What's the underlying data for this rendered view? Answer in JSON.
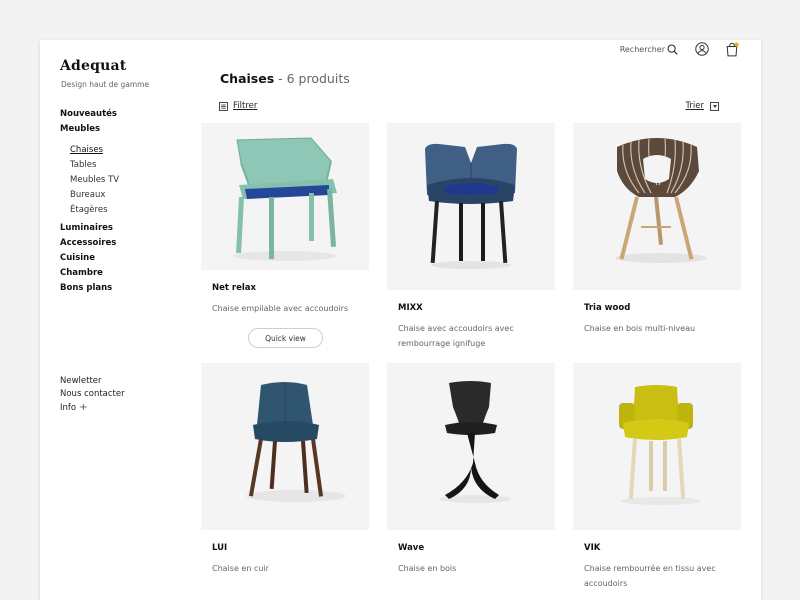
{
  "brand": {
    "logo": "Adequat",
    "tagline": "Design haut de gamme"
  },
  "topbar": {
    "search_label": "Rechercher"
  },
  "nav": {
    "items": [
      "Nouveautés",
      "Meubles",
      "Luminaires",
      "Accessoires",
      "Cuisine",
      "Chambre",
      "Bons plans"
    ],
    "sub_items": [
      "Chaises",
      "Tables",
      "Meubles TV",
      "Bureaux",
      "Étagères"
    ],
    "active_sub": "Chaises"
  },
  "footer": {
    "newsletter": "Newletter",
    "contact": "Nous contacter",
    "info": "Info",
    "info_plus": "+"
  },
  "page": {
    "title": "Chaises",
    "separator": " - ",
    "count": "6 produits",
    "filter_label": "Filtrer",
    "sort_label": "Trier"
  },
  "products": [
    {
      "name": "Net relax",
      "description": "Chaise empilable avec accoudoirs",
      "quick_view": "Quick view",
      "color": "#8fc7b6",
      "image": "mint-plastic-armchair"
    },
    {
      "name": "MIXX",
      "description": "Chaise avec accoudoirs avec rembourrage ignifuge",
      "color": "#3f5f85",
      "image": "blue-upholstered-armchair"
    },
    {
      "name": "Tria wood",
      "description": "Chaise en bois multi-niveau",
      "color": "#5b4a3c",
      "image": "layered-wood-chair"
    },
    {
      "name": "LUI",
      "description": "Chaise en cuir",
      "color": "#2f5570",
      "image": "teal-leather-chair"
    },
    {
      "name": "Wave",
      "description": "Chaise en bois",
      "color": "#2a2a2a",
      "image": "black-wood-chair"
    },
    {
      "name": "VIK",
      "description": "Chaise rembourrée en tissu avec accoudoirs",
      "color": "#c9bf12",
      "image": "yellow-fabric-armchair"
    }
  ]
}
